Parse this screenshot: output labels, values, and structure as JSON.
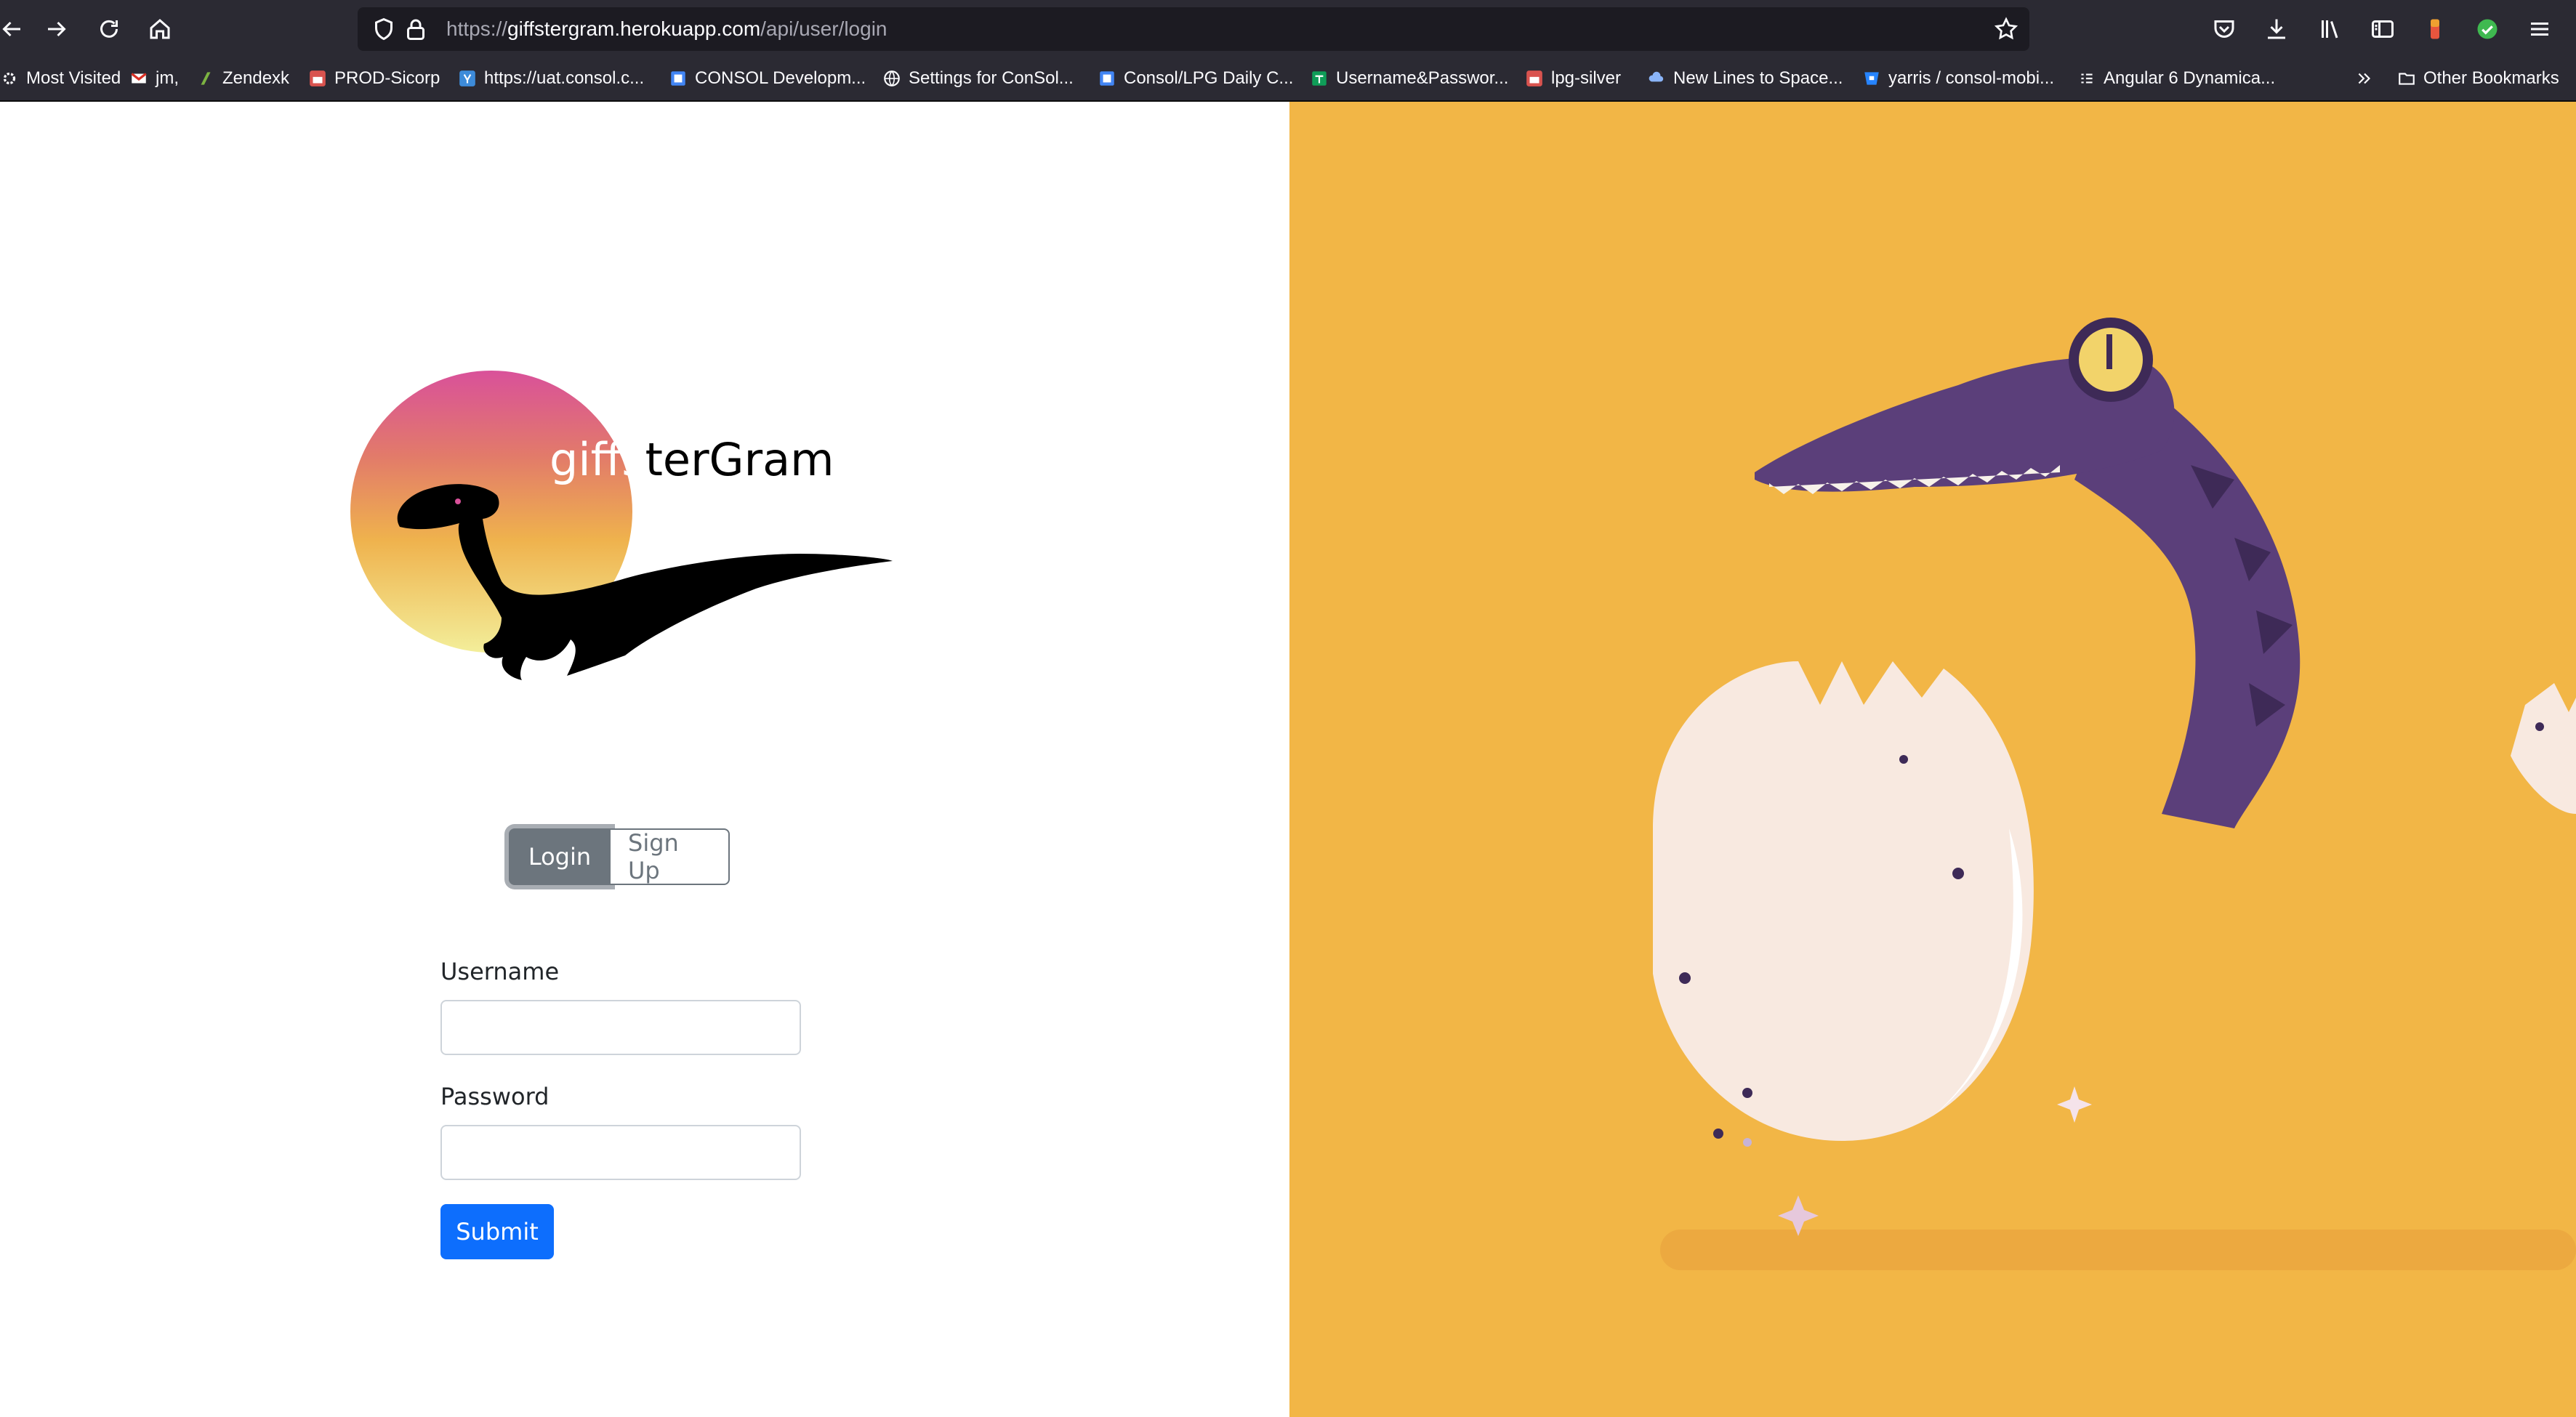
{
  "browser": {
    "url": {
      "scheme": "https://",
      "host": "giffstergram.herokuapp.com",
      "path": "/api/user/login"
    },
    "bookmarks": [
      {
        "label": "Most Visited",
        "icon": "gear-icon"
      },
      {
        "label": "jm,",
        "icon": "gmail-icon"
      },
      {
        "label": "Zendexk",
        "icon": "zendesk-icon"
      },
      {
        "label": "PROD-Sicorp",
        "icon": "site-icon"
      },
      {
        "label": "https://uat.consol.c...",
        "icon": "yammer-icon"
      },
      {
        "label": "CONSOL Developm...",
        "icon": "doc-icon"
      },
      {
        "label": "Settings for ConSol...",
        "icon": "globe-icon"
      },
      {
        "label": "Consol/LPG Daily C...",
        "icon": "doc-icon"
      },
      {
        "label": "Username&Passwor...",
        "icon": "sheets-icon"
      },
      {
        "label": "lpg-silver",
        "icon": "site-icon"
      },
      {
        "label": "New Lines to Space...",
        "icon": "cloud-icon"
      },
      {
        "label": "yarris / consol-mobi...",
        "icon": "bitbucket-icon"
      },
      {
        "label": "Angular 6 Dynamica...",
        "icon": "list-icon"
      },
      {
        "label": "Other Bookmarks",
        "icon": "folder-icon"
      }
    ]
  },
  "logo": {
    "part1": "giffs",
    "part2": "terGram"
  },
  "auth_tabs": {
    "login": "Login",
    "signup": "Sign Up"
  },
  "form": {
    "username_label": "Username",
    "username_value": "",
    "password_label": "Password",
    "password_value": "",
    "submit": "Submit"
  },
  "colors": {
    "accent": "#0d6efd",
    "secondary": "#6c757d",
    "hero_bg": "#f2b646",
    "dino": "#5b3f7a"
  }
}
